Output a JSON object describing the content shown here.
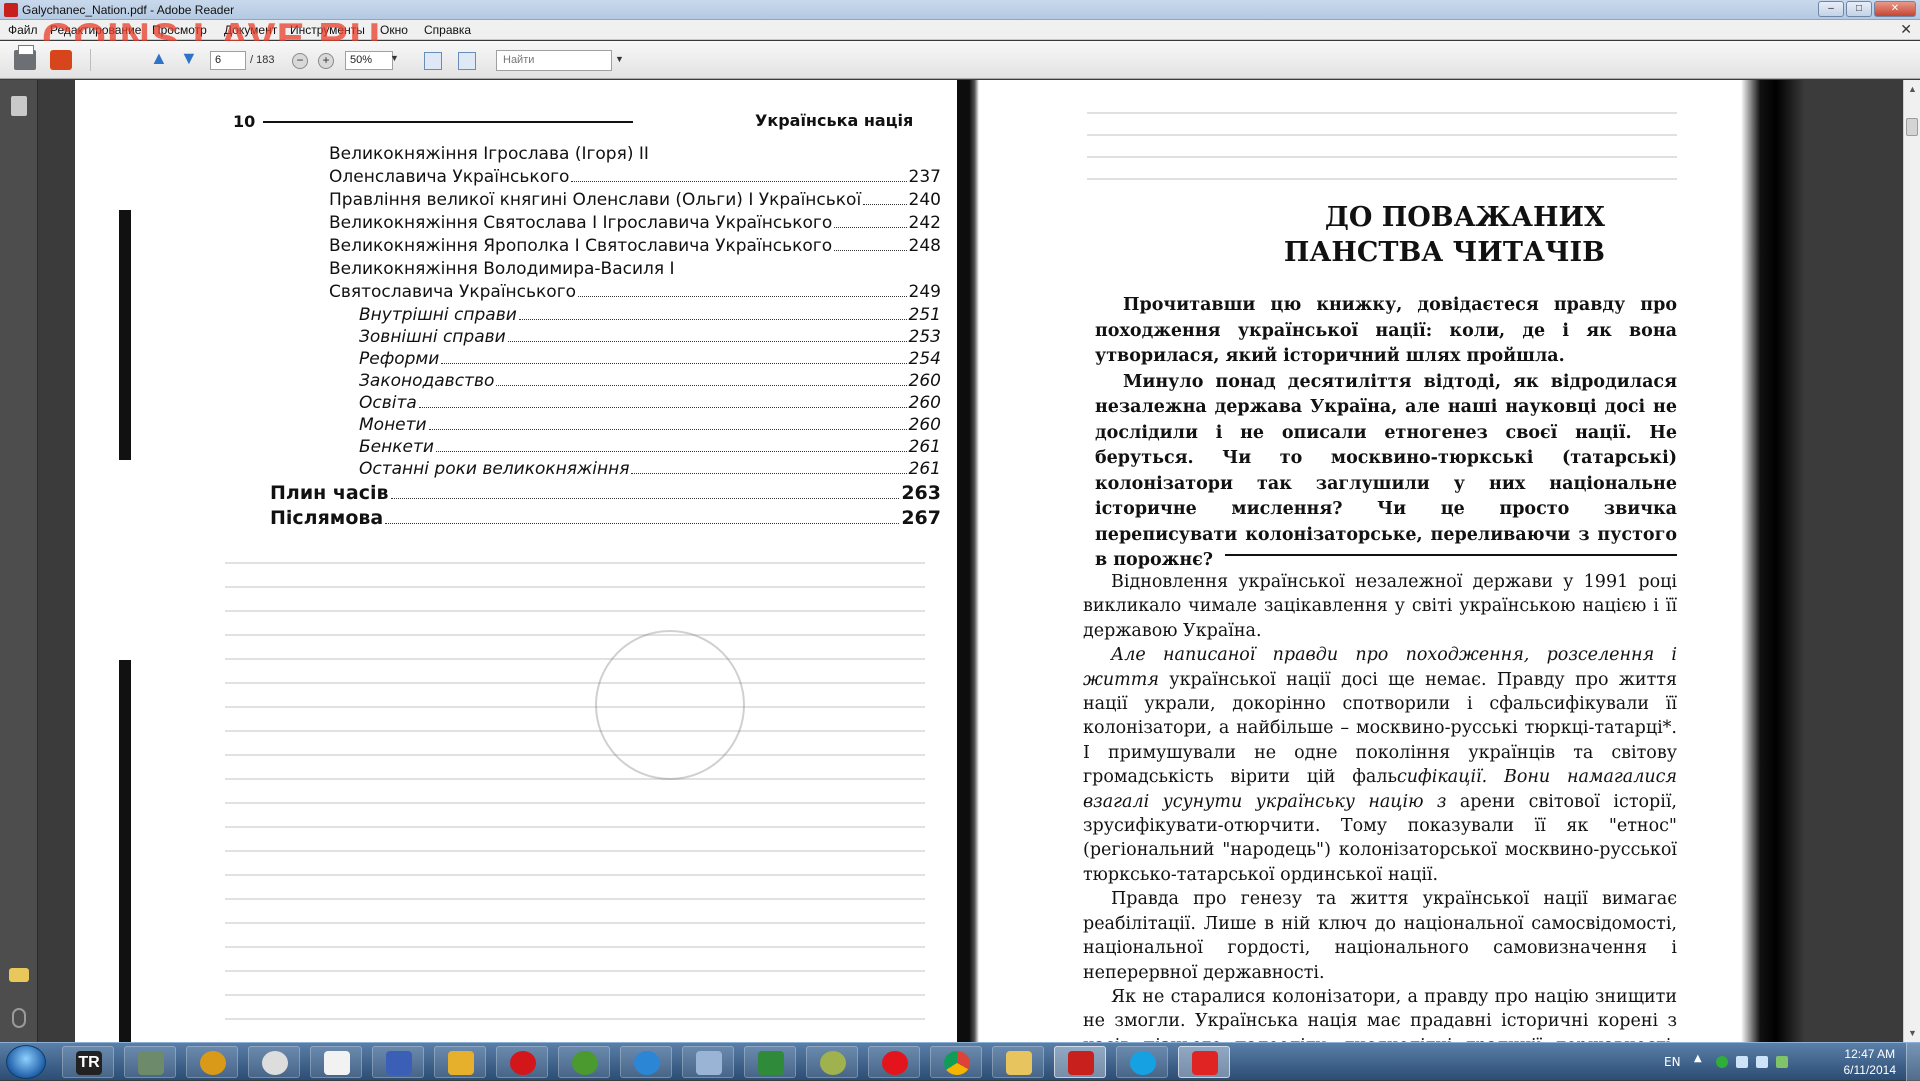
{
  "window": {
    "title": "Galychanec_Nation.pdf - Adobe Reader",
    "watermark": "COINS.LAVE.RU"
  },
  "menu": [
    "Файл",
    "Редактирование",
    "Просмотр",
    "Документ",
    "Инструменты",
    "Окно",
    "Справка"
  ],
  "toolbar": {
    "page_current": "6",
    "page_total": "/ 183",
    "zoom": "50%",
    "find_placeholder": "Найти"
  },
  "left_page": {
    "page_number": "10",
    "running_head": "Українська нація",
    "toc": [
      {
        "level": 1,
        "label": "Великокняжіння Ігрослава (Ігоря) ІІ",
        "page": ""
      },
      {
        "level": 1,
        "label": "Оленславича Українського",
        "page": "237"
      },
      {
        "level": 1,
        "label": "Правління великої княгині Оленслави (Ольги) І Української",
        "page": "240"
      },
      {
        "level": 1,
        "label": "Великокняжіння Святослава І Ігрославича Українського",
        "page": "242"
      },
      {
        "level": 1,
        "label": "Великокняжіння Ярополка І Святославича Українського",
        "page": "248"
      },
      {
        "level": 1,
        "label": "Великокняжіння Володимира-Василя І",
        "page": ""
      },
      {
        "level": 1,
        "label": "Святославича Українського",
        "page": "249"
      },
      {
        "level": 2,
        "label": "Внутрішні справи",
        "page": "251"
      },
      {
        "level": 2,
        "label": "Зовнішні справи",
        "page": "253"
      },
      {
        "level": 2,
        "label": "Реформи",
        "page": "254"
      },
      {
        "level": 2,
        "label": "Законодавство",
        "page": "260"
      },
      {
        "level": 2,
        "label": "Освіта",
        "page": "260"
      },
      {
        "level": 2,
        "label": "Монети",
        "page": "260"
      },
      {
        "level": 2,
        "label": "Бенкети",
        "page": "261"
      },
      {
        "level": 2,
        "label": "Останні роки великокняжіння",
        "page": "261"
      },
      {
        "level": 0,
        "label": "Плин часів",
        "page": "263"
      },
      {
        "level": 0,
        "label": "Післямова",
        "page": "267"
      }
    ]
  },
  "right_page": {
    "heading_line1": "ДО ПОВАЖАНИХ",
    "heading_line2": "ПАНСТВА ЧИТАЧІВ",
    "intro": [
      "Прочитавши цю книжку, довідаєтеся правду про походження української нації: коли, де і як вона утворилася, який історичний шлях пройшла.",
      "Минуло понад десятиліття відтоді, як відродилася незалежна держава Україна, але наші науковці досі не дослідили і не описали етногенез своєї нації. Не беруться. Чи то москвино-тюркські (татарські) колонізатори так заглушили у них національне історичне мислення? Чи це просто звичка переписувати колонізаторське, переливаючи з пустого в порожнє?"
    ],
    "body_p1": "Відновлення української незалежної держави у 1991 році викликало чимале зацікавлення у світі українською нацією і її державою Україна.",
    "body_p2_em1": "Але написаної правди про походження, розселення і життя",
    "body_p2_text1": " української нації досі ще немає. Правду про життя нації украли, докорінно спотворили і сфальсифікували її колонізатори, а найбільше – москвино-русські тюркці-татарці*. І примушували не одне покоління українців та світову громадськість вірити цій фаль",
    "body_p2_em2": "сифікації. Вони намагалися взагалі усунути українську націю з",
    "body_p2_text2": " арени світової історії, зрусифікувати-отюрчити. Тому показували її як \"етнос\" (регіональний \"народець\") колонізаторської москвино-русської тюрксько-татарської ординської нації.",
    "body_p3": "Правда про генезу та життя української нації вимагає реабілітації. Лише в ній ключ до національної самосвідомості, національної гордості, національного самовизначення і неперервної державності.",
    "body_p4": "Як не старалися колонізатори, а правду про націю знищити не змогли. Українська нація має прадавні історичні корені з часів пізнього палеоліту, тисячолітні традиції державності, свою чудову"
  },
  "taskbar": {
    "tr_label": "TR",
    "language": "EN",
    "time": "12:47 AM",
    "date": "6/11/2014",
    "apps": [
      "start",
      "tr",
      "photo",
      "winamp",
      "steam",
      "inkscape",
      "floppy",
      "pencil",
      "opera",
      "utorrent",
      "thunder",
      "pen",
      "excel",
      "onion",
      "opera-red",
      "chrome",
      "explorer",
      "acrobat",
      "skype",
      "seal"
    ]
  }
}
